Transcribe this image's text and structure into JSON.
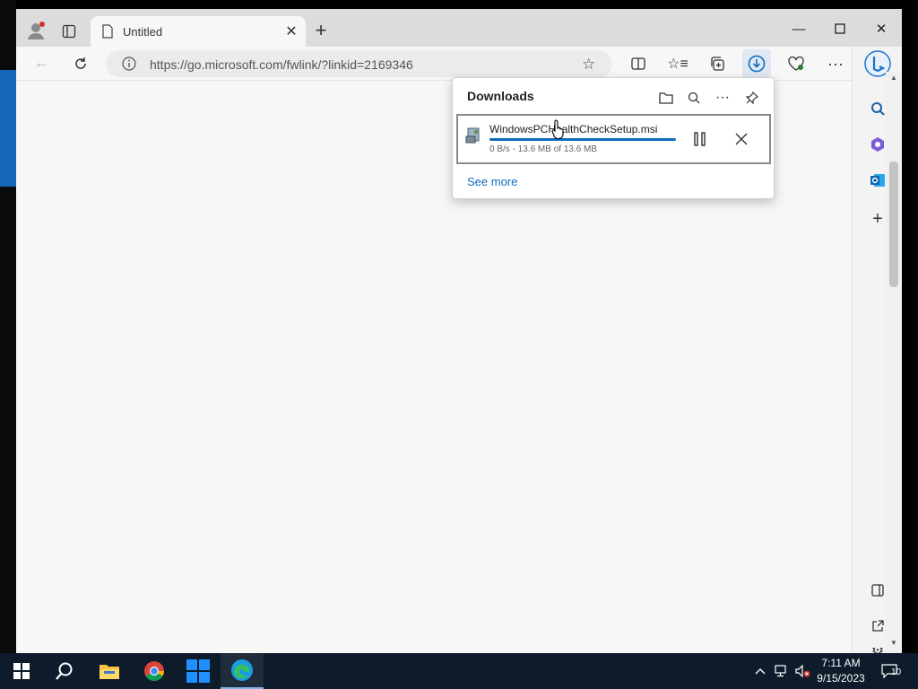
{
  "browser": {
    "tab": {
      "title": "Untitled"
    },
    "address_bar": {
      "url": "https://go.microsoft.com/fwlink/?linkid=2169346"
    }
  },
  "downloads": {
    "title": "Downloads",
    "item": {
      "filename": "WindowsPCHealthCheckSetup.msi",
      "status": "0 B/s - 13.6 MB of 13.6 MB",
      "progress_percent": 100
    },
    "see_more": "See more"
  },
  "taskbar": {
    "apps": [
      "start-button",
      "search",
      "file-explorer",
      "chrome",
      "windows-store-app",
      "edge"
    ],
    "time": "7:11 AM",
    "date": "9/15/2023",
    "notification_count": "10"
  },
  "colors": {
    "accent": "#0f6cbd",
    "taskbar": "#0d1b2a"
  }
}
